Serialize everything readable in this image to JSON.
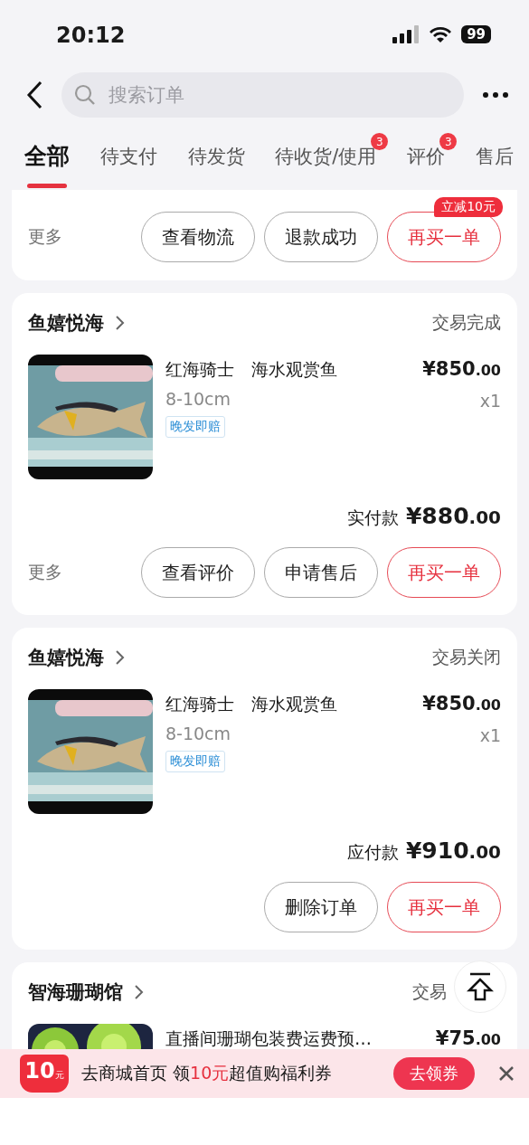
{
  "status_bar": {
    "time": "20:12",
    "battery": "99"
  },
  "nav": {
    "search": {
      "placeholder": "搜索订单"
    }
  },
  "tabs": [
    {
      "label": "全部",
      "selected": true
    },
    {
      "label": "待支付",
      "selected": false
    },
    {
      "label": "待发货",
      "selected": false
    },
    {
      "label": "待收货/使用",
      "selected": false,
      "badge": "3"
    },
    {
      "label": "评价",
      "selected": false,
      "badge": "3"
    },
    {
      "label": "售后",
      "selected": false
    }
  ],
  "orders": [
    {
      "kind": "partial",
      "more": "更多",
      "buttons": [
        {
          "label": "查看物流",
          "primary": false
        },
        {
          "label": "退款成功",
          "primary": false
        },
        {
          "label": "再买一单",
          "primary": true,
          "tag": "立减10元"
        }
      ]
    },
    {
      "kind": "full",
      "shop": "鱼嬉悦海",
      "status": "交易完成",
      "item": {
        "kind": "picture",
        "title": "红海骑士　海水观赏鱼",
        "spec": "8-10cm",
        "tag": "晚发即赔",
        "price_main": "¥850",
        "price_decimal": ".00",
        "qty": "x1"
      },
      "total_label": "实付款",
      "total_main": "¥880",
      "total_decimal": ".00",
      "more": "更多",
      "buttons": [
        {
          "label": "查看评价",
          "primary": false
        },
        {
          "label": "申请售后",
          "primary": false
        },
        {
          "label": "再买一单",
          "primary": true
        }
      ]
    },
    {
      "kind": "full",
      "shop": "鱼嬉悦海",
      "status": "交易关闭",
      "item": {
        "kind": "picture",
        "title": "红海骑士　海水观赏鱼",
        "spec": "8-10cm",
        "tag": "晚发即赔",
        "price_main": "¥850",
        "price_decimal": ".00",
        "qty": "x1"
      },
      "total_label": "应付款",
      "total_main": "¥910",
      "total_decimal": ".00",
      "buttons": [
        {
          "label": "删除订单",
          "primary": false
        },
        {
          "label": "再买一单",
          "primary": true
        }
      ]
    },
    {
      "kind": "cut",
      "shop": "智海珊瑚馆",
      "status": "交易",
      "item": {
        "kind": "picture",
        "title": "直播间珊瑚包装费运费预…",
        "price_main": "¥75",
        "price_decimal": ".00"
      }
    }
  ],
  "coupon": {
    "amount": "10",
    "unit": "元",
    "text_before": "去商城首页 领",
    "highlight": "10元",
    "text_after": "超值购福利券",
    "button": "去领券"
  }
}
